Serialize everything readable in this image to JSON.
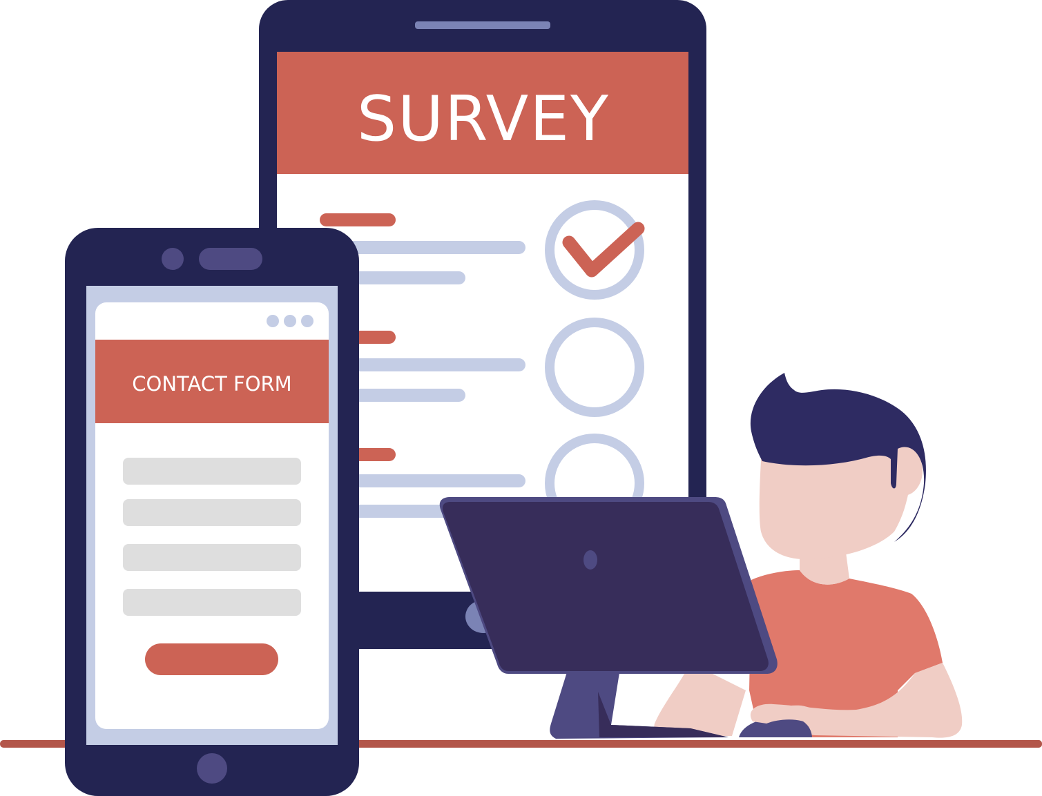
{
  "colors": {
    "device_navy": "#232452",
    "accent_red": "#cc6355",
    "light_lavender": "#c4cde5",
    "field_gray": "#dedede",
    "purple_button": "#4e4a82",
    "slot_gray_blue": "#7b83b5",
    "monitor_back": "#372d5a",
    "monitor_rim": "#4e4a82",
    "hair": "#2e2b62",
    "skin": "#f0cdc5",
    "shirt": "#e0796b",
    "desk": "#b3564a",
    "white": "#ffffff"
  },
  "tablet": {
    "header_title": "SURVEY",
    "questions": [
      {
        "answered": true,
        "icon": "check-circle-icon"
      },
      {
        "answered": false,
        "icon": "empty-circle-icon"
      },
      {
        "answered": false,
        "icon": "empty-circle-icon"
      }
    ]
  },
  "phone": {
    "window_dots_icon": "more-dots-icon",
    "form_title": "CONTACT FORM",
    "field_count": 4,
    "submit_button_label": ""
  }
}
